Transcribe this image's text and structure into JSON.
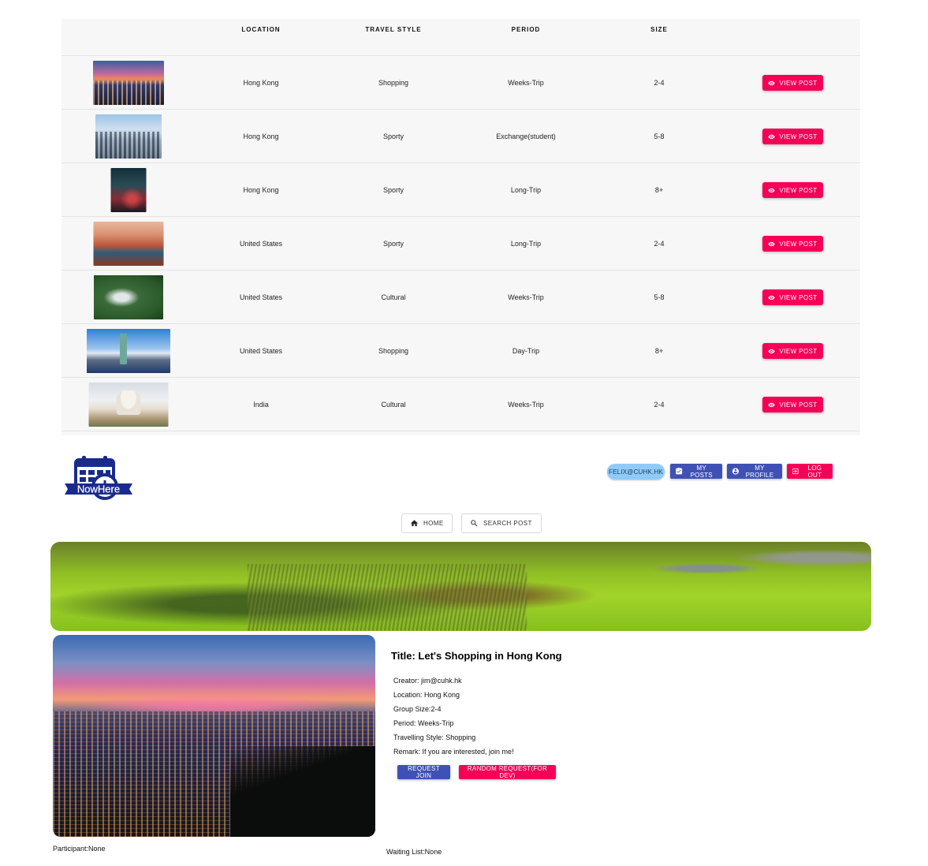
{
  "table": {
    "headers": [
      "",
      "LOCATION",
      "TRAVEL STYLE",
      "PERIOD",
      "SIZE",
      ""
    ],
    "view_label": "VIEW POST",
    "rows": [
      {
        "image": "hong-kong-night-skyline",
        "location": "Hong Kong",
        "style": "Shopping",
        "period": "Weeks-Trip",
        "size": "2-4"
      },
      {
        "image": "hong-kong-day-skyline",
        "location": "Hong Kong",
        "style": "Sporty",
        "period": "Exchange(student)",
        "size": "5-8"
      },
      {
        "image": "hong-kong-street-night",
        "location": "Hong Kong",
        "style": "Sporty",
        "period": "Long-Trip",
        "size": "8+"
      },
      {
        "image": "canyon-river",
        "location": "United States",
        "style": "Sporty",
        "period": "Long-Trip",
        "size": "2-4"
      },
      {
        "image": "waterfall-forest",
        "location": "United States",
        "style": "Cultural",
        "period": "Weeks-Trip",
        "size": "5-8"
      },
      {
        "image": "statue-of-liberty",
        "location": "United States",
        "style": "Shopping",
        "period": "Day-Trip",
        "size": "8+"
      },
      {
        "image": "taj-mahal",
        "location": "India",
        "style": "Cultural",
        "period": "Weeks-Trip",
        "size": "2-4"
      }
    ]
  },
  "header": {
    "logo_text": "NowHere",
    "user_email": "FELIX@CUHK.HK",
    "my_posts": "MY POSTS",
    "my_profile": "MY PROFILE",
    "logout": "LOG OUT"
  },
  "nav": {
    "home": "HOME",
    "search": "SEARCH POST"
  },
  "post": {
    "title": "Title: Let's Shopping in Hong Kong",
    "creator": "Creator: jim@cuhk.hk",
    "location": "Location: Hong Kong",
    "group_size": "Group Size:2-4",
    "period": "Period: Weeks-Trip",
    "style": "Travelling Style: Shopping",
    "remark": "Remark: If you are interested, join me!",
    "request_join": "REQUEST JOIN",
    "random_request": "RANDOM REQUEST(FOR DEV)",
    "participant": "Participant:None",
    "waiting": "Waiting List:None"
  },
  "colors": {
    "primary": "#3f51b5",
    "secondary": "#f50057",
    "chip": "#90caf9"
  }
}
